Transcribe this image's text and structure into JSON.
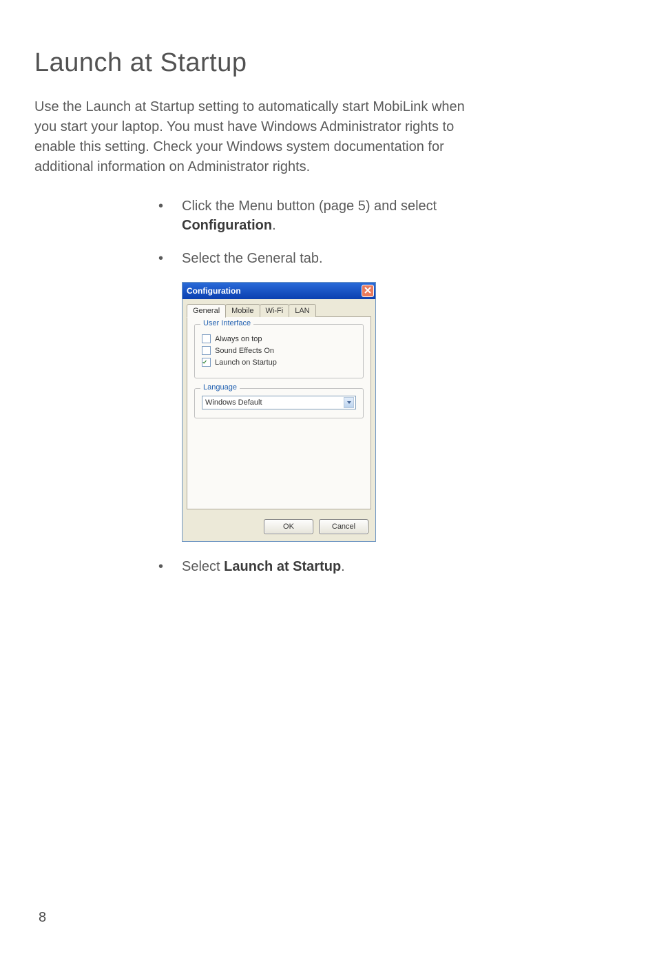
{
  "page": {
    "title": "Launch at Startup",
    "intro": "Use the Launch at Startup setting to automatically start MobiLink when you start your laptop. You must have Windows Administrator rights to enable this setting. Check your Windows system documentation for additional information on Administrator rights.",
    "number": "8"
  },
  "steps": {
    "s1_pre": "Click the Menu button (page 5) and select ",
    "s1_bold": "Configuration",
    "s1_post": ".",
    "s2": "Select the General tab.",
    "s3_pre": "Select ",
    "s3_bold": "Launch at Startup",
    "s3_post": "."
  },
  "dialog": {
    "title": "Configuration",
    "tabs": {
      "general": "General",
      "mobile": "Mobile",
      "wifi": "Wi-Fi",
      "lan": "LAN"
    },
    "group_ui": "User Interface",
    "chk_always_on_top": "Always on top",
    "chk_sound_effects": "Sound Effects On",
    "chk_launch_startup": "Launch on Startup",
    "group_language": "Language",
    "language_value": "Windows Default",
    "ok": "OK",
    "cancel": "Cancel"
  }
}
